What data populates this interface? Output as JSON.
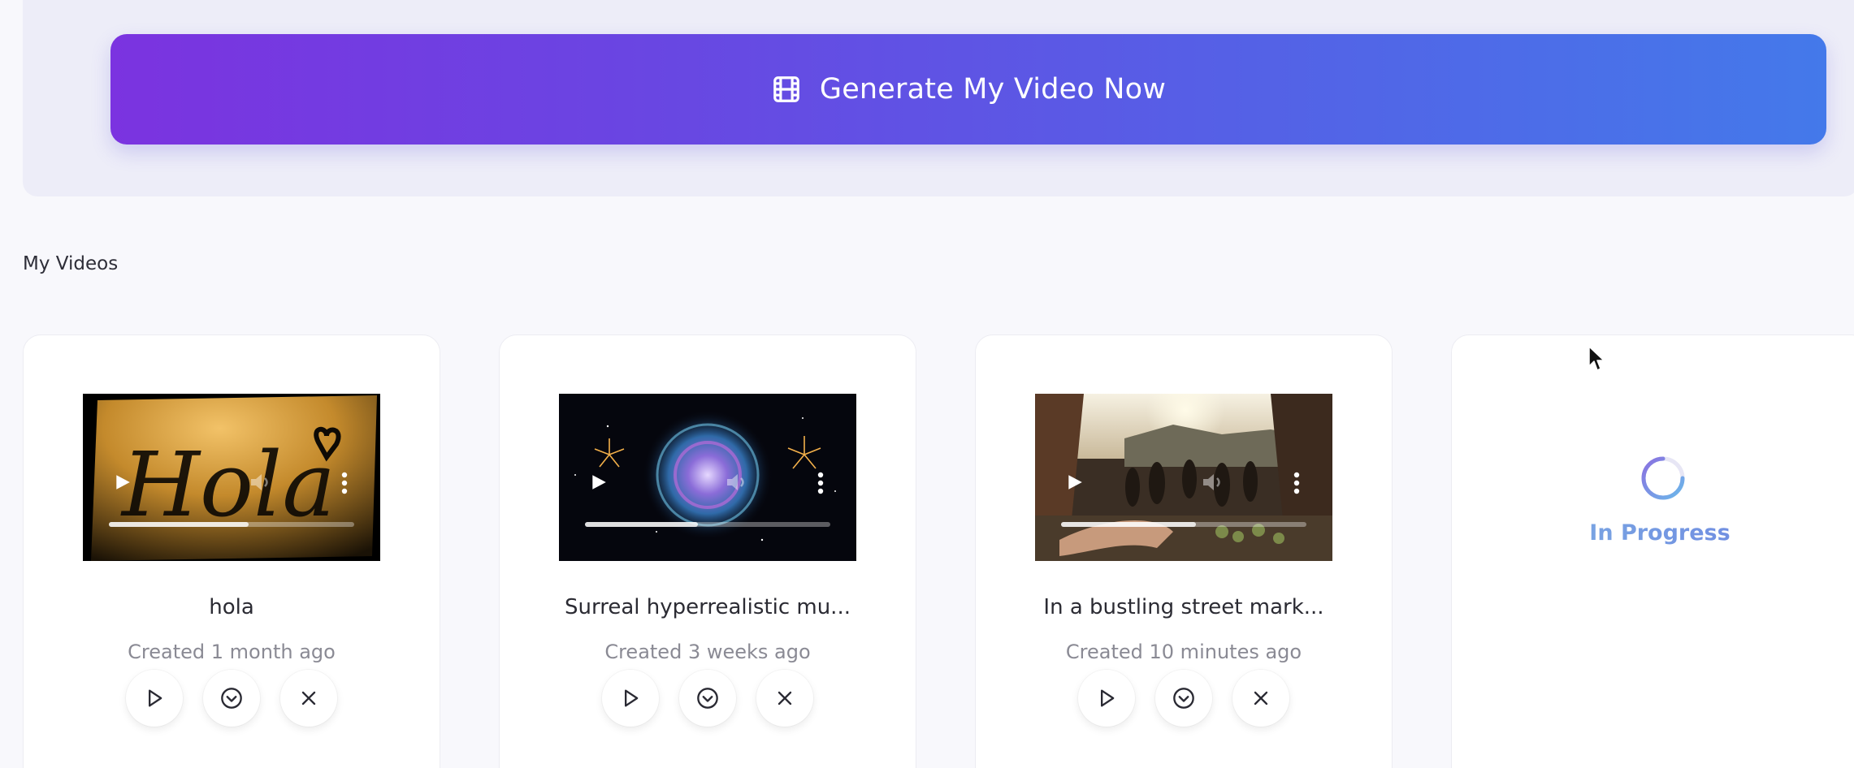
{
  "generate": {
    "label": "Generate My Video Now",
    "icon": "film-icon",
    "gradient": [
      "#7b33e0",
      "#4479ea"
    ]
  },
  "section": {
    "title": "My Videos"
  },
  "videos": [
    {
      "title": "hola",
      "created": "Created 1 month ago",
      "progress": 0.57,
      "thumbnail": "hola-handwriting"
    },
    {
      "title": "Surreal hyperrealistic mu...",
      "created": "Created 3 weeks ago",
      "progress": 0.46,
      "thumbnail": "glowing-orb-fireworks"
    },
    {
      "title": "In a bustling street mark...",
      "created": "Created 10 minutes ago",
      "progress": 0.55,
      "thumbnail": "street-market"
    }
  ],
  "pending": {
    "status": "In Progress",
    "icon": "spinner-icon"
  },
  "actions": [
    "play-icon",
    "chevron-down-circle-icon",
    "close-icon"
  ]
}
